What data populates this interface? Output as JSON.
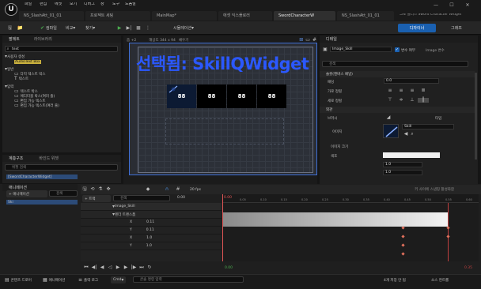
{
  "menu": [
    "파일",
    "편집",
    "에셋",
    "보기",
    "디버그",
    "창",
    "도구",
    "도움말"
  ],
  "tabs": [
    "NS_SlashAtt_01_01",
    "프로젝트 세팅",
    "MainMap*",
    "애셋 익스플로러",
    "SwordCharacterW",
    "NS_SlashAtt_01_01"
  ],
  "window_right": "그로 플러스  Sword Character Widget",
  "toolbar": {
    "compile": "컴파일",
    "diff": "비교",
    "find": "찾기",
    "play": "▶",
    "simulation": "시뮬레이션",
    "designer": "디자이너",
    "graph": "그래프"
  },
  "palette": {
    "title": "팔레트",
    "library_tab": "라이브러리",
    "search": "text",
    "groups": [
      {
        "label": "사용자 생성",
        "items": [
          "AudioText Box"
        ]
      },
      {
        "label": "일반",
        "items": [
          "다지 텍스트 박스",
          "텍스트"
        ]
      },
      {
        "label": "입력",
        "items": [
          "텍스트 박스",
          "에디터블 박스(여러 줄)",
          "편집 가능 텍스트",
          "편집 가능 텍스트(여러 줄)"
        ]
      }
    ]
  },
  "hierarchy": {
    "title": "계층구조",
    "bind_tab": "바인드 위젯",
    "search": "위젯 검색",
    "root": "[SwordCharacterWidget]"
  },
  "canvas": {
    "zoom": "줌 +2",
    "dpi": "DPI 스케일 1.0",
    "resolution": "해상도 344 x 94",
    "fill": "채우기",
    "selected_text": "선택됨: SkillQWidget",
    "slots": [
      "88",
      "88",
      "88",
      "88"
    ]
  },
  "details": {
    "title": "디테일",
    "name": "Image_Skill",
    "is_variable_label": "변수 여부",
    "is_variable": true,
    "subtitle": "Image 변수",
    "search": "검색",
    "sections": [
      "슬롯(캔버스 패널)",
      "외관",
      "브러시"
    ],
    "padding_label": "패딩",
    "padding_value": "0.0",
    "h_align_label": "가로 정렬",
    "v_align_label": "세로 정렬",
    "brush_label": "브러시",
    "brush_dropdown": "타입",
    "image_label": "이미지",
    "image_value": "Skill",
    "image_size_label": "이미지 크기",
    "tint_label": "색조",
    "tint_values": [
      "1.0",
      "1.0"
    ]
  },
  "timeline": {
    "animation_tab": "애니메이션",
    "add_button": "+ 애니메이션",
    "search": "검색",
    "track_add": "+ 트랙",
    "fps": "20 fps",
    "frame": "0.00",
    "time_labels": [
      "0.05",
      "0.10",
      "0.15",
      "0.20",
      "0.25",
      "0.30",
      "0.35",
      "0.40",
      "0.45",
      "0.50",
      "0.55",
      "0.60"
    ],
    "tracks": [
      {
        "label": "Image_Skill",
        "value": ""
      },
      {
        "label": "렌더 트랜스폼",
        "value": ""
      },
      {
        "label": "X",
        "value": "0.11"
      },
      {
        "label": "Y",
        "value": "0.11"
      },
      {
        "label": "X",
        "value": "1.0"
      },
      {
        "label": "Y",
        "value": "1.0"
      }
    ],
    "anim_item": "Ski",
    "right_status": "키 사이에 스냅핑 활성화함",
    "range_start": "0.00",
    "range_end": "0.35",
    "bottom_start": "0.00",
    "bottom_end": "0.35"
  },
  "statusbar": {
    "content_drawer": "콘텐츠 드로어",
    "output_log": "출력 로그",
    "cmd": "Cmd",
    "cmd_placeholder": "콘솔 명령 입력",
    "unsaved": "4개 저장 안 됨",
    "source_control": "소스 컨트롤"
  }
}
